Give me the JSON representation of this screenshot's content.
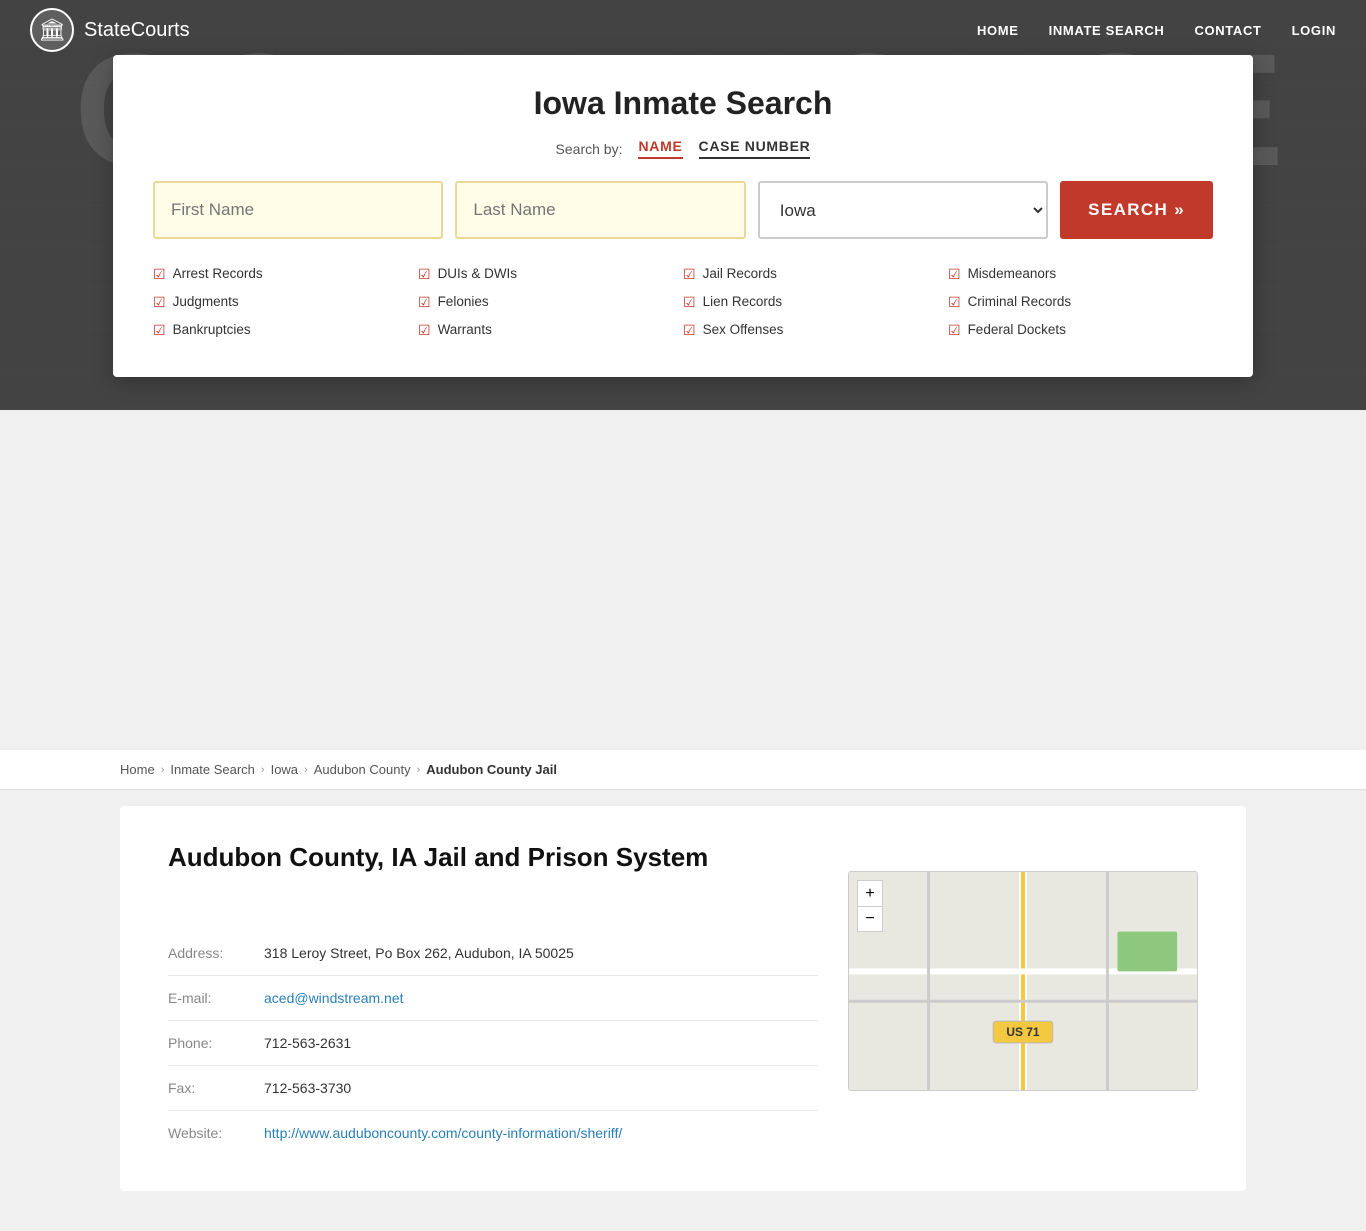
{
  "site": {
    "logo_icon": "🏛",
    "logo_name": "StateCourts",
    "logo_name_bold": "State",
    "logo_name_light": "Courts"
  },
  "nav": {
    "links": [
      {
        "label": "HOME",
        "id": "home"
      },
      {
        "label": "INMATE SEARCH",
        "id": "inmate-search"
      },
      {
        "label": "CONTACT",
        "id": "contact"
      },
      {
        "label": "LOGIN",
        "id": "login"
      }
    ]
  },
  "hero_bg_text": "COURTHOUSE",
  "search_card": {
    "title": "Iowa Inmate Search",
    "search_by_label": "Search by:",
    "tab_name": "NAME",
    "tab_case": "CASE NUMBER",
    "first_name_placeholder": "First Name",
    "last_name_placeholder": "Last Name",
    "state_value": "Iowa",
    "search_btn": "SEARCH »",
    "checklist": [
      {
        "label": "Arrest Records"
      },
      {
        "label": "DUIs & DWIs"
      },
      {
        "label": "Jail Records"
      },
      {
        "label": "Misdemeanors"
      },
      {
        "label": "Judgments"
      },
      {
        "label": "Felonies"
      },
      {
        "label": "Lien Records"
      },
      {
        "label": "Criminal Records"
      },
      {
        "label": "Bankruptcies"
      },
      {
        "label": "Warrants"
      },
      {
        "label": "Sex Offenses"
      },
      {
        "label": "Federal Dockets"
      }
    ]
  },
  "breadcrumb": {
    "items": [
      {
        "label": "Home",
        "id": "home"
      },
      {
        "label": "Inmate Search",
        "id": "inmate-search"
      },
      {
        "label": "Iowa",
        "id": "iowa"
      },
      {
        "label": "Audubon County",
        "id": "audubon-county"
      },
      {
        "label": "Audubon County Jail",
        "id": "audubon-county-jail",
        "current": true
      }
    ]
  },
  "facility": {
    "title": "Audubon County, IA Jail and Prison System",
    "address_label": "Address:",
    "address_value": "318 Leroy Street, Po Box 262, Audubon, IA 50025",
    "email_label": "E-mail:",
    "email_value": "aced@windstream.net",
    "phone_label": "Phone:",
    "phone_value": "712-563-2631",
    "fax_label": "Fax:",
    "fax_value": "712-563-3730",
    "website_label": "Website:",
    "website_value": "http://www.auduboncounty.com/county-information/sheriff/",
    "map_label": "US 71"
  },
  "colors": {
    "accent": "#c0392b",
    "link": "#2980b9"
  }
}
